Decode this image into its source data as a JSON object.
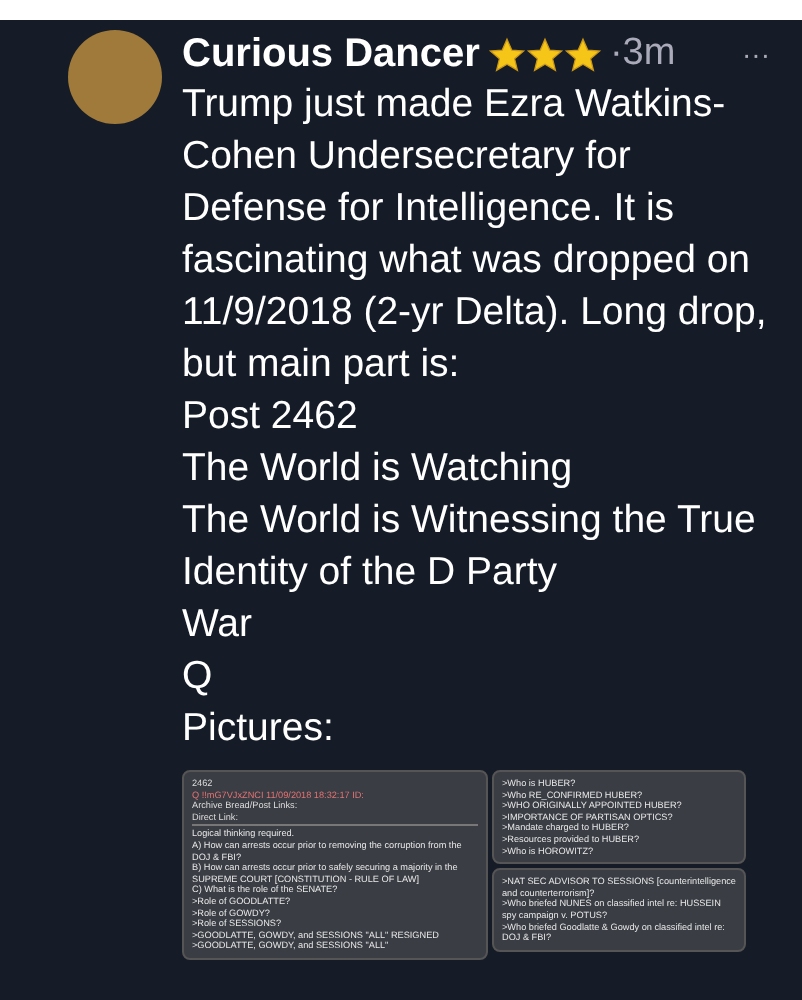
{
  "post": {
    "author": "Curious Dancer",
    "stars": 3,
    "time": "·3m",
    "more": "···",
    "intro": "Trump just made Ezra Watkins-Cohen Undersecretary for Defense for Intelligence. It is fascinating what was dropped on 11/9/2018 (2-yr Delta). Long drop, but main part is:",
    "lines": [
      "Post 2462",
      "The World is Watching",
      "The World is Witnessing the True Identity of the D Party",
      "War",
      "Q",
      "Pictures:"
    ]
  },
  "pictures": [
    {
      "header": [
        "2462",
        "Q !!mG7VJxZNCI 11/09/2018 18:32:17 ID:",
        "Archive Bread/Post Links:",
        "Direct Link:"
      ],
      "lines": [
        "Logical thinking required.",
        "A)   How can arrests occur prior to removing the corruption from the DOJ & FBI?",
        "B)   How can arrests occur prior to safely securing a majority in the SUPREME COURT [CONSTITUTION - RULE OF LAW]",
        "C)   What is the role of the SENATE?",
        ">Role of GOODLATTE?",
        ">Role of GOWDY?",
        ">Role of SESSIONS?",
        ">GOODLATTE, GOWDY, and SESSIONS \"ALL\" RESIGNED",
        ">GOODLATTE, GOWDY, and SESSIONS \"ALL\""
      ]
    },
    {
      "lines": [
        ">Who is HUBER?",
        ">Who RE_CONFIRMED HUBER?",
        ">WHO ORIGINALLY APPOINTED HUBER?",
        ">IMPORTANCE OF PARTISAN OPTICS?",
        ">Mandate charged to HUBER?",
        ">Resources provided to HUBER?",
        ">Who is HOROWITZ?"
      ]
    },
    {
      "lines": [
        ">NAT SEC ADVISOR TO SESSIONS [counterintelligence and counterterrorism]?",
        ">Who briefed NUNES on classified intel re: HUSSEIN spy campaign v. POTUS?",
        ">Who briefed Goodlatte & Gowdy on classified intel re: DOJ & FBI?"
      ]
    }
  ]
}
